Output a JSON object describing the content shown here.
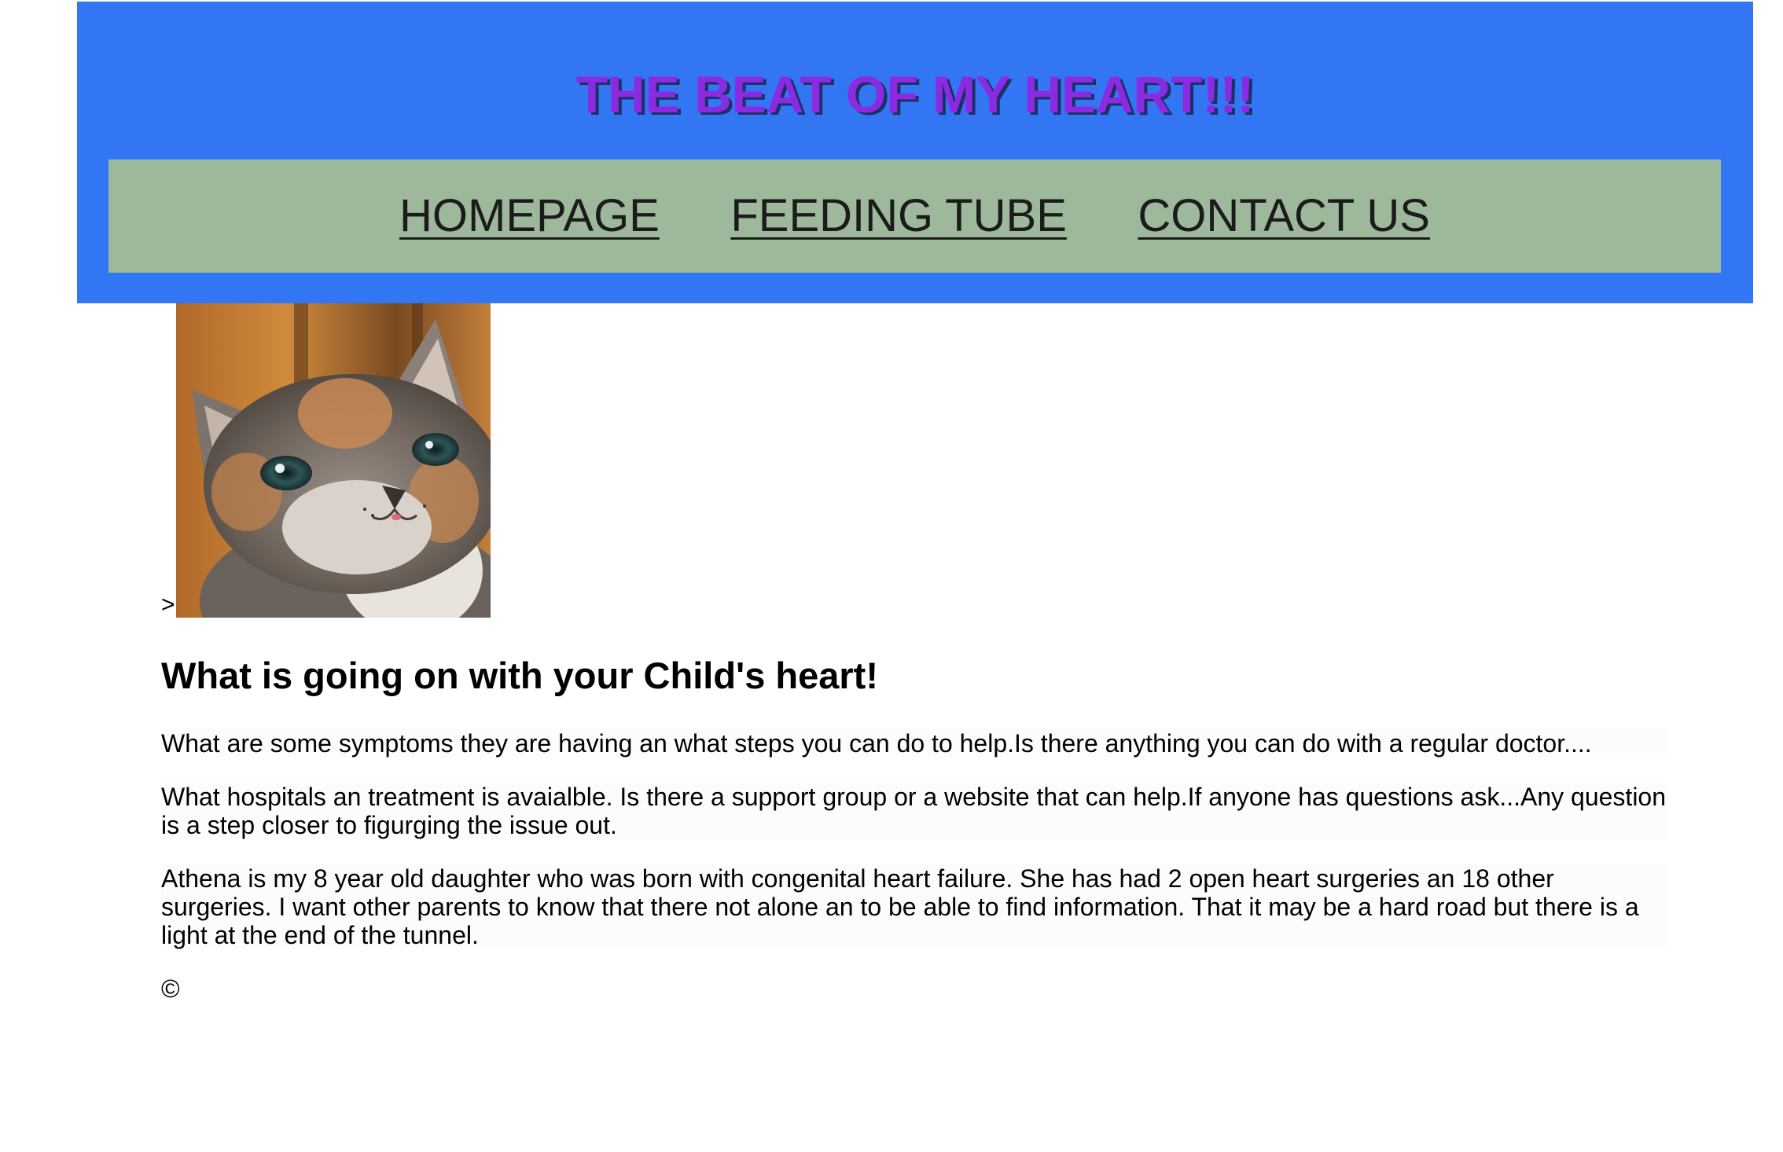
{
  "header": {
    "title": "THE BEAT OF MY HEART!!!",
    "background_color": "#3276f3",
    "title_color": "#8a2be2"
  },
  "nav": {
    "background_color": "#9eb89b",
    "items": [
      {
        "label": "HOMEPAGE"
      },
      {
        "label": "FEEDING TUBE"
      },
      {
        "label": "CONTACT US"
      }
    ]
  },
  "hero": {
    "prefix_text": ">",
    "image": "kitten-photo"
  },
  "main": {
    "heading": "What is going on with your Child's heart!",
    "paragraphs": [
      "What are some symptoms they are having an what steps you can do to help.Is there anything you can do with a regular doctor....",
      "What hospitals an treatment is avaialble. Is there a support group or a website that can help.If anyone has questions ask...Any question is a step closer to figurging the issue out.",
      "Athena is my 8 year old daughter who was born with congenital heart failure. She has had 2 open heart surgeries an 18 other surgeries. I want other parents to know that there not alone an to be able to find information. That it may be a hard road but there is a light at the end of the tunnel."
    ]
  },
  "footer": {
    "copyright": "©"
  }
}
